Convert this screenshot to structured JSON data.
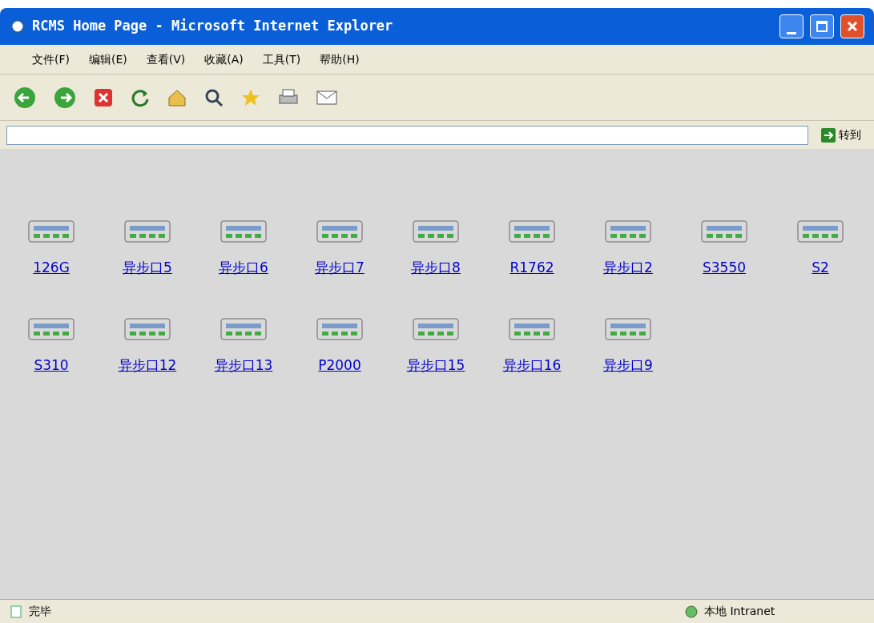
{
  "window": {
    "title": "RCMS Home Page - Microsoft Internet Explorer"
  },
  "menu": [
    "文件(F)",
    "编辑(E)",
    "查看(V)",
    "收藏(A)",
    "工具(T)",
    "帮助(H)"
  ],
  "address_bar": {
    "go_label": "转到"
  },
  "device_rows": [
    {
      "devices": [
        {
          "label": "126G"
        },
        {
          "label": "异步口5"
        },
        {
          "label": "异步口6"
        },
        {
          "label": "异步口7"
        },
        {
          "label": "异步口8"
        },
        {
          "label": "R1762"
        },
        {
          "label": "异步口2"
        },
        {
          "label": "S3550"
        },
        {
          "label": "S2"
        }
      ]
    },
    {
      "devices": [
        {
          "label": "S310"
        },
        {
          "label": "异步口12"
        },
        {
          "label": "异步口13"
        },
        {
          "label": "P2000"
        },
        {
          "label": "异步口15"
        },
        {
          "label": "异步口16"
        },
        {
          "label": "异步口9"
        }
      ]
    }
  ],
  "status_bar": {
    "status": "完毕",
    "zone": "本地 Intranet"
  }
}
